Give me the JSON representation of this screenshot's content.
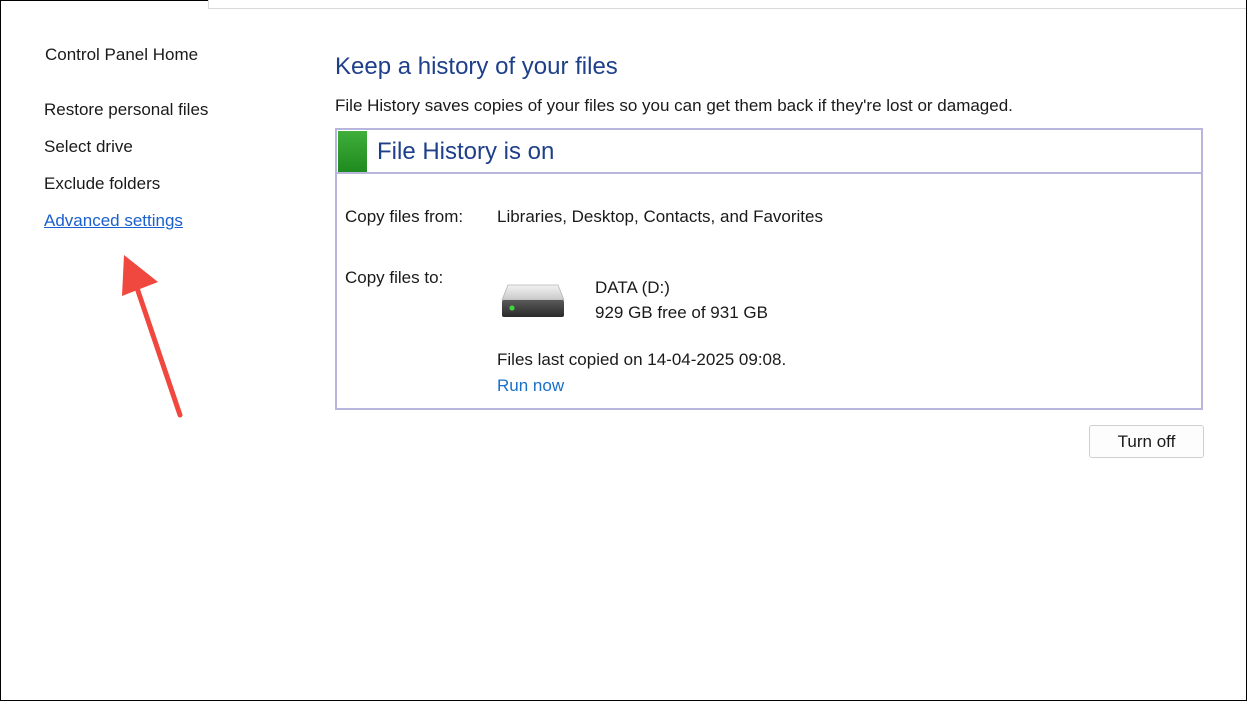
{
  "sidebar": {
    "home": "Control Panel Home",
    "items": [
      {
        "label": "Restore personal files"
      },
      {
        "label": "Select drive"
      },
      {
        "label": "Exclude folders"
      },
      {
        "label": "Advanced settings"
      }
    ]
  },
  "main": {
    "title": "Keep a history of your files",
    "description": "File History saves copies of your files so you can get them back if they're lost or damaged.",
    "status": {
      "title": "File History is on",
      "indicator_color": "#2e9e2e",
      "copy_from_label": "Copy files from:",
      "copy_from_value": "Libraries, Desktop, Contacts, and Favorites",
      "copy_to_label": "Copy files to:",
      "drive_name": "DATA (D:)",
      "drive_space": "929 GB free of 931 GB",
      "last_copied": "Files last copied on 14-04-2025 09:08.",
      "run_now": "Run now"
    },
    "turn_off_button": "Turn off"
  },
  "colors": {
    "link_blue": "#1a5fd0",
    "title_blue": "#1e3f8a",
    "box_border": "#b8b6dc",
    "arrow_red": "#f0473e"
  },
  "icons": {
    "drive": "hard-drive-icon",
    "annotation": "red-arrow-icon"
  }
}
